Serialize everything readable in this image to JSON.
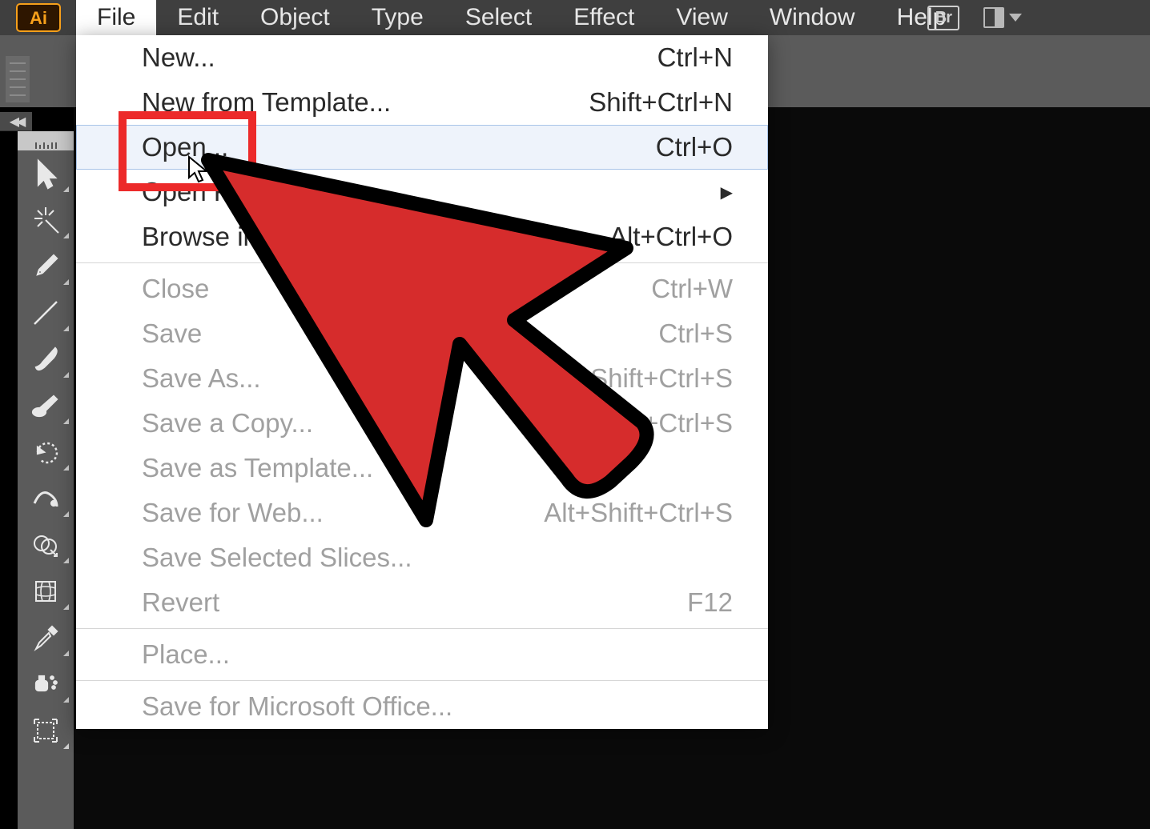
{
  "app": {
    "logo_text": "Ai",
    "bridge_label": "Br"
  },
  "menubar": {
    "items": [
      {
        "label": "File",
        "active": true
      },
      {
        "label": "Edit"
      },
      {
        "label": "Object"
      },
      {
        "label": "Type"
      },
      {
        "label": "Select"
      },
      {
        "label": "Effect"
      },
      {
        "label": "View"
      },
      {
        "label": "Window"
      },
      {
        "label": "Help"
      }
    ]
  },
  "file_menu": {
    "groups": [
      [
        {
          "label": "New...",
          "shortcut": "Ctrl+N",
          "disabled": false
        },
        {
          "label": "New from Template...",
          "shortcut": "Shift+Ctrl+N",
          "disabled": false
        },
        {
          "label": "Open...",
          "shortcut": "Ctrl+O",
          "disabled": false,
          "hovered": true,
          "highlighted": true
        },
        {
          "label": "Open Recent Files",
          "shortcut": "",
          "disabled": false,
          "submenu": true
        },
        {
          "label": "Browse in Bridge...",
          "shortcut": "Alt+Ctrl+O",
          "disabled": false
        }
      ],
      [
        {
          "label": "Close",
          "shortcut": "Ctrl+W",
          "disabled": true
        },
        {
          "label": "Save",
          "shortcut": "Ctrl+S",
          "disabled": true
        },
        {
          "label": "Save As...",
          "shortcut": "Shift+Ctrl+S",
          "disabled": true
        },
        {
          "label": "Save a Copy...",
          "shortcut": "Alt+Ctrl+S",
          "disabled": true
        },
        {
          "label": "Save as Template...",
          "shortcut": "",
          "disabled": true
        },
        {
          "label": "Save for Web...",
          "shortcut": "Alt+Shift+Ctrl+S",
          "disabled": true
        },
        {
          "label": "Save Selected Slices...",
          "shortcut": "",
          "disabled": true
        },
        {
          "label": "Revert",
          "shortcut": "F12",
          "disabled": true
        }
      ],
      [
        {
          "label": "Place...",
          "shortcut": "",
          "disabled": true
        }
      ],
      [
        {
          "label": "Save for Microsoft Office...",
          "shortcut": "",
          "disabled": true
        }
      ]
    ]
  },
  "toolbar": {
    "tools": [
      "selection-tool",
      "magic-wand-tool",
      "pen-tool",
      "line-tool",
      "paintbrush-tool",
      "blob-brush-tool",
      "rotate-tool",
      "width-tool",
      "shape-builder-tool",
      "mesh-tool",
      "eyedropper-tool",
      "symbol-sprayer-tool",
      "artboard-tool"
    ]
  },
  "collapse_glyph": "◀◀",
  "annotation": {
    "cursor_color": "#d62c2c",
    "cursor_stroke": "#000000"
  }
}
